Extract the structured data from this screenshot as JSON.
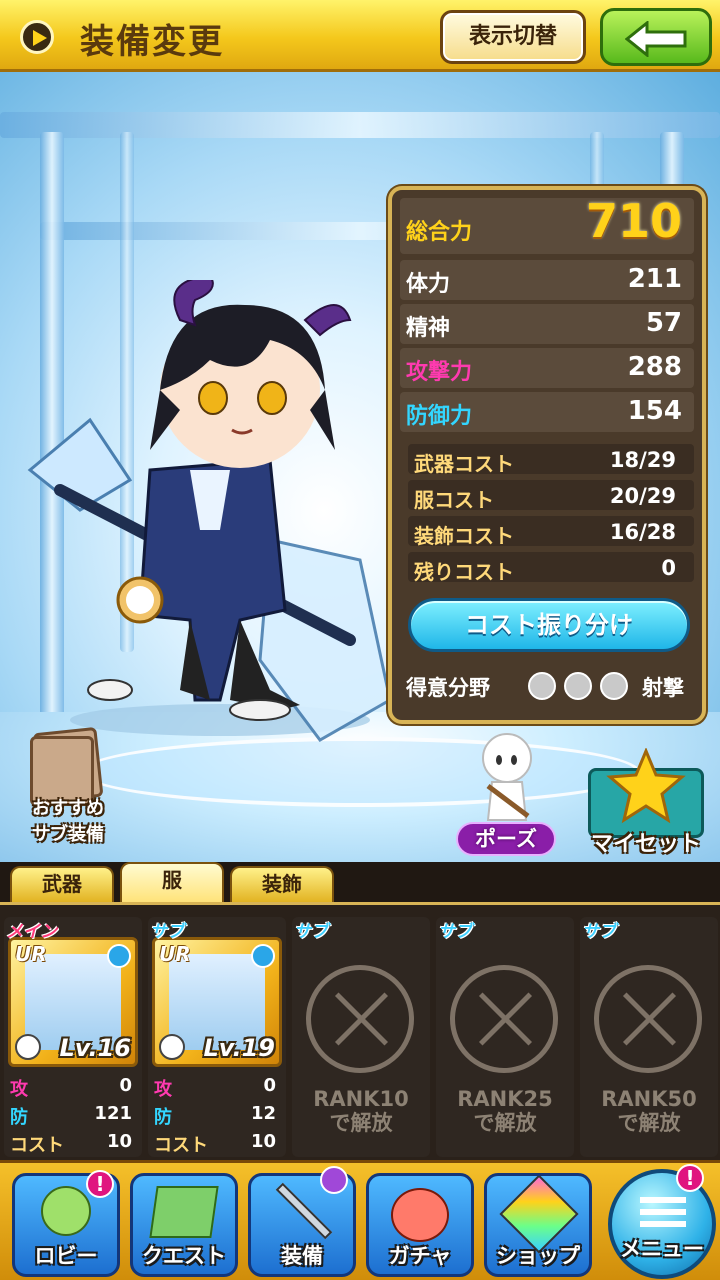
{
  "header": {
    "title": "装備変更",
    "toggle_label": "表示切替"
  },
  "stats": {
    "total_label": "総合力",
    "total_value": "710",
    "rows": [
      {
        "label": "体力",
        "value": "211"
      },
      {
        "label": "精神",
        "value": "57"
      },
      {
        "label": "攻撃力",
        "value": "288"
      },
      {
        "label": "防御力",
        "value": "154"
      }
    ],
    "costs": [
      {
        "label": "武器コスト",
        "value": "18/29"
      },
      {
        "label": "服コスト",
        "value": "20/29"
      },
      {
        "label": "装飾コスト",
        "value": "16/28"
      },
      {
        "label": "残りコスト",
        "value": "0"
      }
    ],
    "distribute_label": "コスト振り分け",
    "specialty_label": "得意分野",
    "specialty_value": "射撃"
  },
  "side_buttons": {
    "recommend_line1": "おすすめ",
    "recommend_line2": "サブ装備",
    "pose": "ポーズ",
    "myset": "マイセット"
  },
  "tabs": [
    "武器",
    "服",
    "装飾"
  ],
  "slots": [
    {
      "tag": "メイン",
      "rarity": "UR",
      "level": "Lv.16",
      "atk_k": "攻",
      "atk": "0",
      "def_k": "防",
      "def": "121",
      "cost_k": "コスト",
      "cost": "10"
    },
    {
      "tag": "サブ",
      "rarity": "UR",
      "level": "Lv.19",
      "atk_k": "攻",
      "atk": "0",
      "def_k": "防",
      "def": "12",
      "cost_k": "コスト",
      "cost": "10"
    },
    {
      "tag": "サブ",
      "rank_line1": "RANK10",
      "rank_line2": "で解放"
    },
    {
      "tag": "サブ",
      "rank_line1": "RANK25",
      "rank_line2": "で解放"
    },
    {
      "tag": "サブ",
      "rank_line1": "RANK50",
      "rank_line2": "で解放"
    }
  ],
  "nav": [
    {
      "label": "ロビー",
      "icon": "lobby-icon"
    },
    {
      "label": "クエスト",
      "icon": "quest-icon"
    },
    {
      "label": "装備",
      "icon": "equip-icon"
    },
    {
      "label": "ガチャ",
      "icon": "gacha-icon"
    },
    {
      "label": "ショップ",
      "icon": "shop-icon"
    },
    {
      "label": "メニュー",
      "icon": "menu-icon"
    }
  ],
  "badge_text": "!",
  "colors": {
    "header": "#f4c81c",
    "total": "#ffd21a",
    "attack": "#ff3ab0",
    "defense": "#33d6ff"
  }
}
